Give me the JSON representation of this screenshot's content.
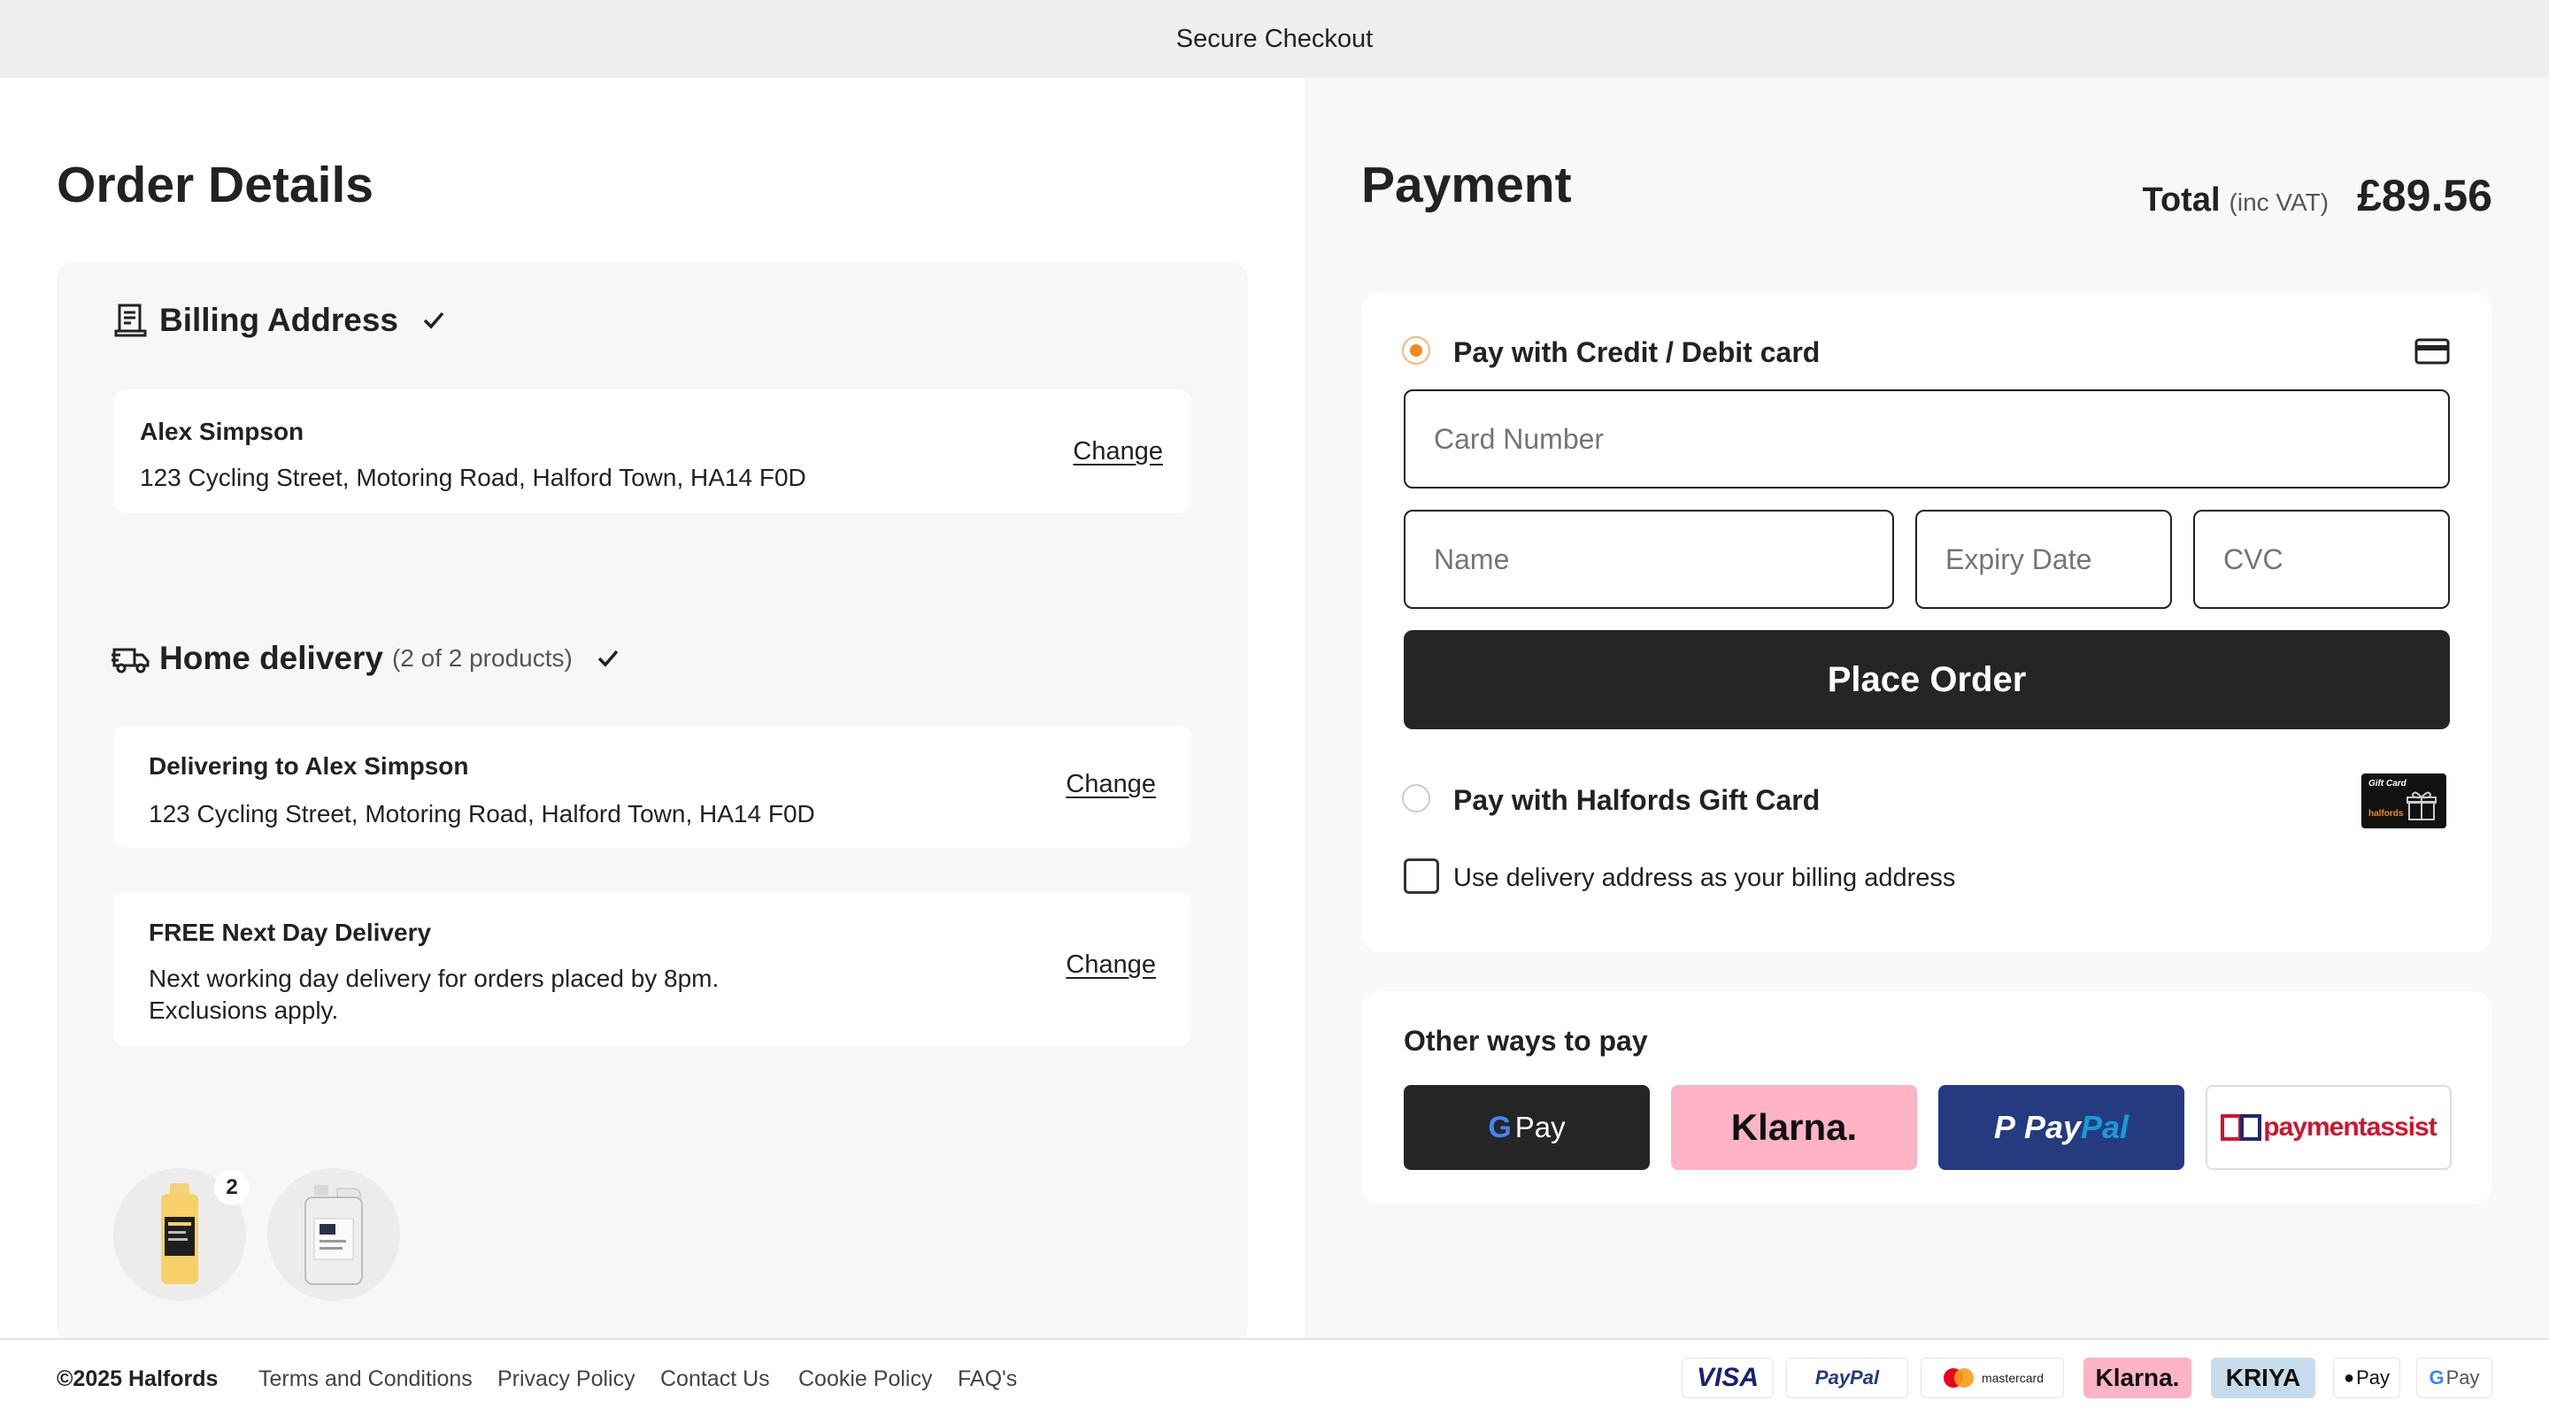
{
  "topbar": {
    "title": "Secure Checkout"
  },
  "order": {
    "heading": "Order Details",
    "billing": {
      "title": "Billing Address",
      "name": "Alex Simpson",
      "address": "123 Cycling Street, Motoring Road, Halford Town, HA14 F0D",
      "change_label": "Change"
    },
    "delivery": {
      "title": "Home delivery",
      "count": "(2 of 2 products)",
      "to_label": "Delivering to Alex Simpson",
      "address": "123 Cycling Street, Motoring Road, Halford Town, HA14 F0D",
      "change_label": "Change",
      "method_title": "FREE Next Day Delivery",
      "method_line1": "Next working day delivery for orders placed by 8pm.",
      "method_line2": "Exclusions apply.",
      "method_change_label": "Change"
    },
    "products": [
      {
        "name": "bottle-product",
        "qty": "2"
      },
      {
        "name": "jerrycan-product",
        "qty": ""
      }
    ]
  },
  "payment": {
    "heading": "Payment",
    "total_label": "Total",
    "total_sub": "(inc VAT)",
    "total_amount": "£89.56",
    "card_option": "Pay with Credit / Debit card",
    "card_number_placeholder": "Card Number",
    "name_placeholder": "Name",
    "expiry_placeholder": "Expiry Date",
    "cvc_placeholder": "CVC",
    "place_order": "Place Order",
    "gift_option": "Pay with Halfords Gift Card",
    "gift_card_text": "Gift Card",
    "gift_card_brand": "halfords",
    "billing_checkbox": "Use delivery address as your billing address",
    "other_title": "Other ways to pay",
    "gpay_text": "Pay",
    "klarna_text": "Klarna.",
    "paypal_text_1": "Pay",
    "paypal_text_2": "Pal",
    "paymentassist_text": "paymentassist"
  },
  "footer": {
    "copyright": "©2025 Halfords",
    "links": [
      "Terms and Conditions",
      "Privacy Policy",
      "Contact Us",
      "Cookie Policy",
      "FAQ's"
    ],
    "payment_logos": [
      "VISA",
      "PayPal",
      "mastercard",
      "Klarna.",
      "KRIYA",
      "Pay",
      "Pay"
    ]
  },
  "colors": {
    "accent_orange": "#f08a1c",
    "dark_button": "#252525",
    "klarna_pink": "#ffb3c7",
    "paypal_blue": "#253b80",
    "paypal_light": "#179bd7",
    "paymentassist_red": "#d0142c",
    "paymentassist_navy": "#1a2a6c"
  }
}
